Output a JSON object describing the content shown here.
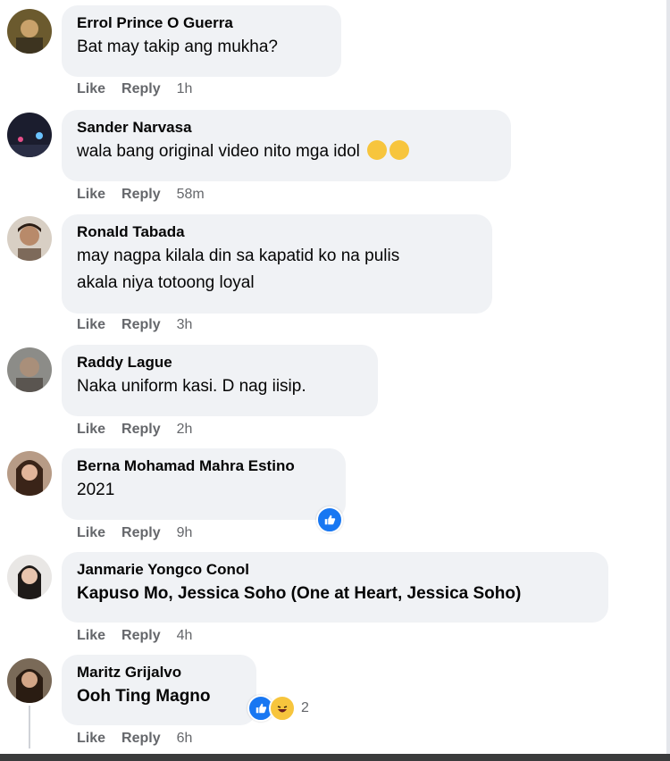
{
  "comments": [
    {
      "author": "Errol Prince O Guerra",
      "text": "Bat may takip ang mukha?",
      "like": "Like",
      "reply": "Reply",
      "time": "1h"
    },
    {
      "author": "Sander Narvasa",
      "text": "wala bang original video nito mga idol",
      "emoji": [
        "rolling-laughing-emoji",
        "grinning-sweat-emoji"
      ],
      "like": "Like",
      "reply": "Reply",
      "time": "58m"
    },
    {
      "author": "Ronald Tabada",
      "text_line1": "may nagpa kilala din sa kapatid ko na pulis",
      "text_line2": "akala niya totoong loyal",
      "like": "Like",
      "reply": "Reply",
      "time": "3h"
    },
    {
      "author": "Raddy Lague",
      "text": "Naka uniform kasi. D nag iisip.",
      "like": "Like",
      "reply": "Reply",
      "time": "2h"
    },
    {
      "author": "Berna Mohamad Mahra Estino",
      "text": "2021",
      "reaction": "like-icon",
      "like": "Like",
      "reply": "Reply",
      "time": "9h"
    },
    {
      "author": "Janmarie Yongco Conol",
      "text": "Kapuso Mo, Jessica Soho (One at Heart, Jessica Soho)",
      "like": "Like",
      "reply": "Reply",
      "time": "4h"
    },
    {
      "author": "Maritz Grijalvo",
      "text": "Ooh Ting Magno",
      "reactions": [
        "like-icon",
        "haha-icon"
      ],
      "reaction_count": "2",
      "like": "Like",
      "reply": "Reply",
      "time": "6h"
    }
  ],
  "colors": {
    "bubble": "#f0f2f5",
    "meta": "#65676b",
    "like_blue": "#1877f2",
    "emoji_yellow": "#f7c53d"
  }
}
